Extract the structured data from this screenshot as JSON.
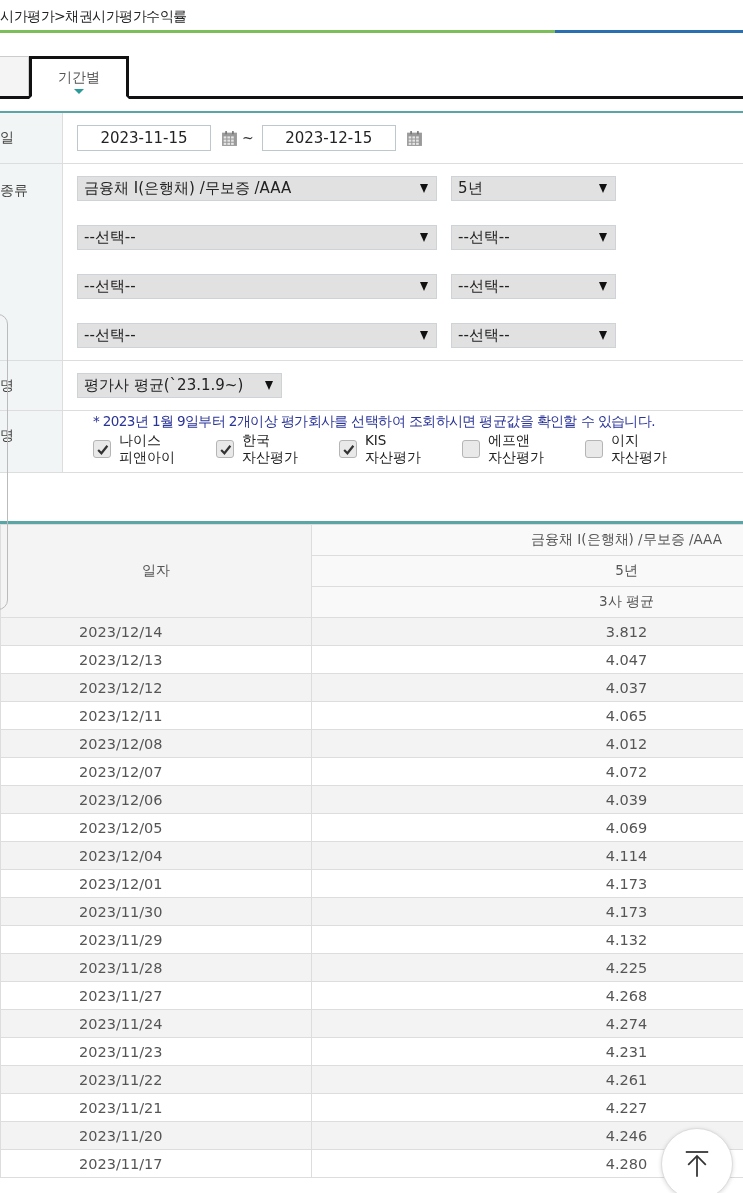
{
  "breadcrumb": "시가평가>채권시가평가수익률",
  "tabs": [
    {
      "selected": false
    },
    {
      "label": "기간별",
      "selected": true
    }
  ],
  "form": {
    "date": {
      "label": "일",
      "from": "2023-11-15",
      "separator": "~",
      "to": "2023-12-15"
    },
    "bond": {
      "label": "종류",
      "rows": [
        {
          "type": "금융채 I(은행채) /무보증 /AAA",
          "term": "5년"
        },
        {
          "type": "--선택--",
          "term": "--선택--"
        },
        {
          "type": "--선택--",
          "term": "--선택--"
        },
        {
          "type": "--선택--",
          "term": "--선택--"
        }
      ]
    },
    "evaluator": {
      "label": "명",
      "value": "평가사 평균(`23.1.9~)"
    },
    "companies": {
      "label": "명",
      "notice": "* 2023년 1월 9일부터 2개이상 평가회사를 선택하여 조회하시면 평균값을 확인할 수 있습니다.",
      "items": [
        {
          "label": "나이스\n피앤아이",
          "checked": true
        },
        {
          "label": "한국\n자산평가",
          "checked": true
        },
        {
          "label": "KIS\n자산평가",
          "checked": true
        },
        {
          "label": "에프앤\n자산평가",
          "checked": false
        },
        {
          "label": "이지\n자산평가",
          "checked": false
        }
      ]
    }
  },
  "table": {
    "header": {
      "date": "일자",
      "bond": "금융채 I(은행채) /무보증 /AAA",
      "term": "5년",
      "source": "3사 평균"
    },
    "rows": [
      [
        "2023/12/14",
        "3.812"
      ],
      [
        "2023/12/13",
        "4.047"
      ],
      [
        "2023/12/12",
        "4.037"
      ],
      [
        "2023/12/11",
        "4.065"
      ],
      [
        "2023/12/08",
        "4.012"
      ],
      [
        "2023/12/07",
        "4.072"
      ],
      [
        "2023/12/06",
        "4.039"
      ],
      [
        "2023/12/05",
        "4.069"
      ],
      [
        "2023/12/04",
        "4.114"
      ],
      [
        "2023/12/01",
        "4.173"
      ],
      [
        "2023/11/30",
        "4.173"
      ],
      [
        "2023/11/29",
        "4.132"
      ],
      [
        "2023/11/28",
        "4.225"
      ],
      [
        "2023/11/27",
        "4.268"
      ],
      [
        "2023/11/24",
        "4.274"
      ],
      [
        "2023/11/23",
        "4.231"
      ],
      [
        "2023/11/22",
        "4.261"
      ],
      [
        "2023/11/21",
        "4.227"
      ],
      [
        "2023/11/20",
        "4.246"
      ],
      [
        "2023/11/17",
        "4.280"
      ]
    ]
  }
}
